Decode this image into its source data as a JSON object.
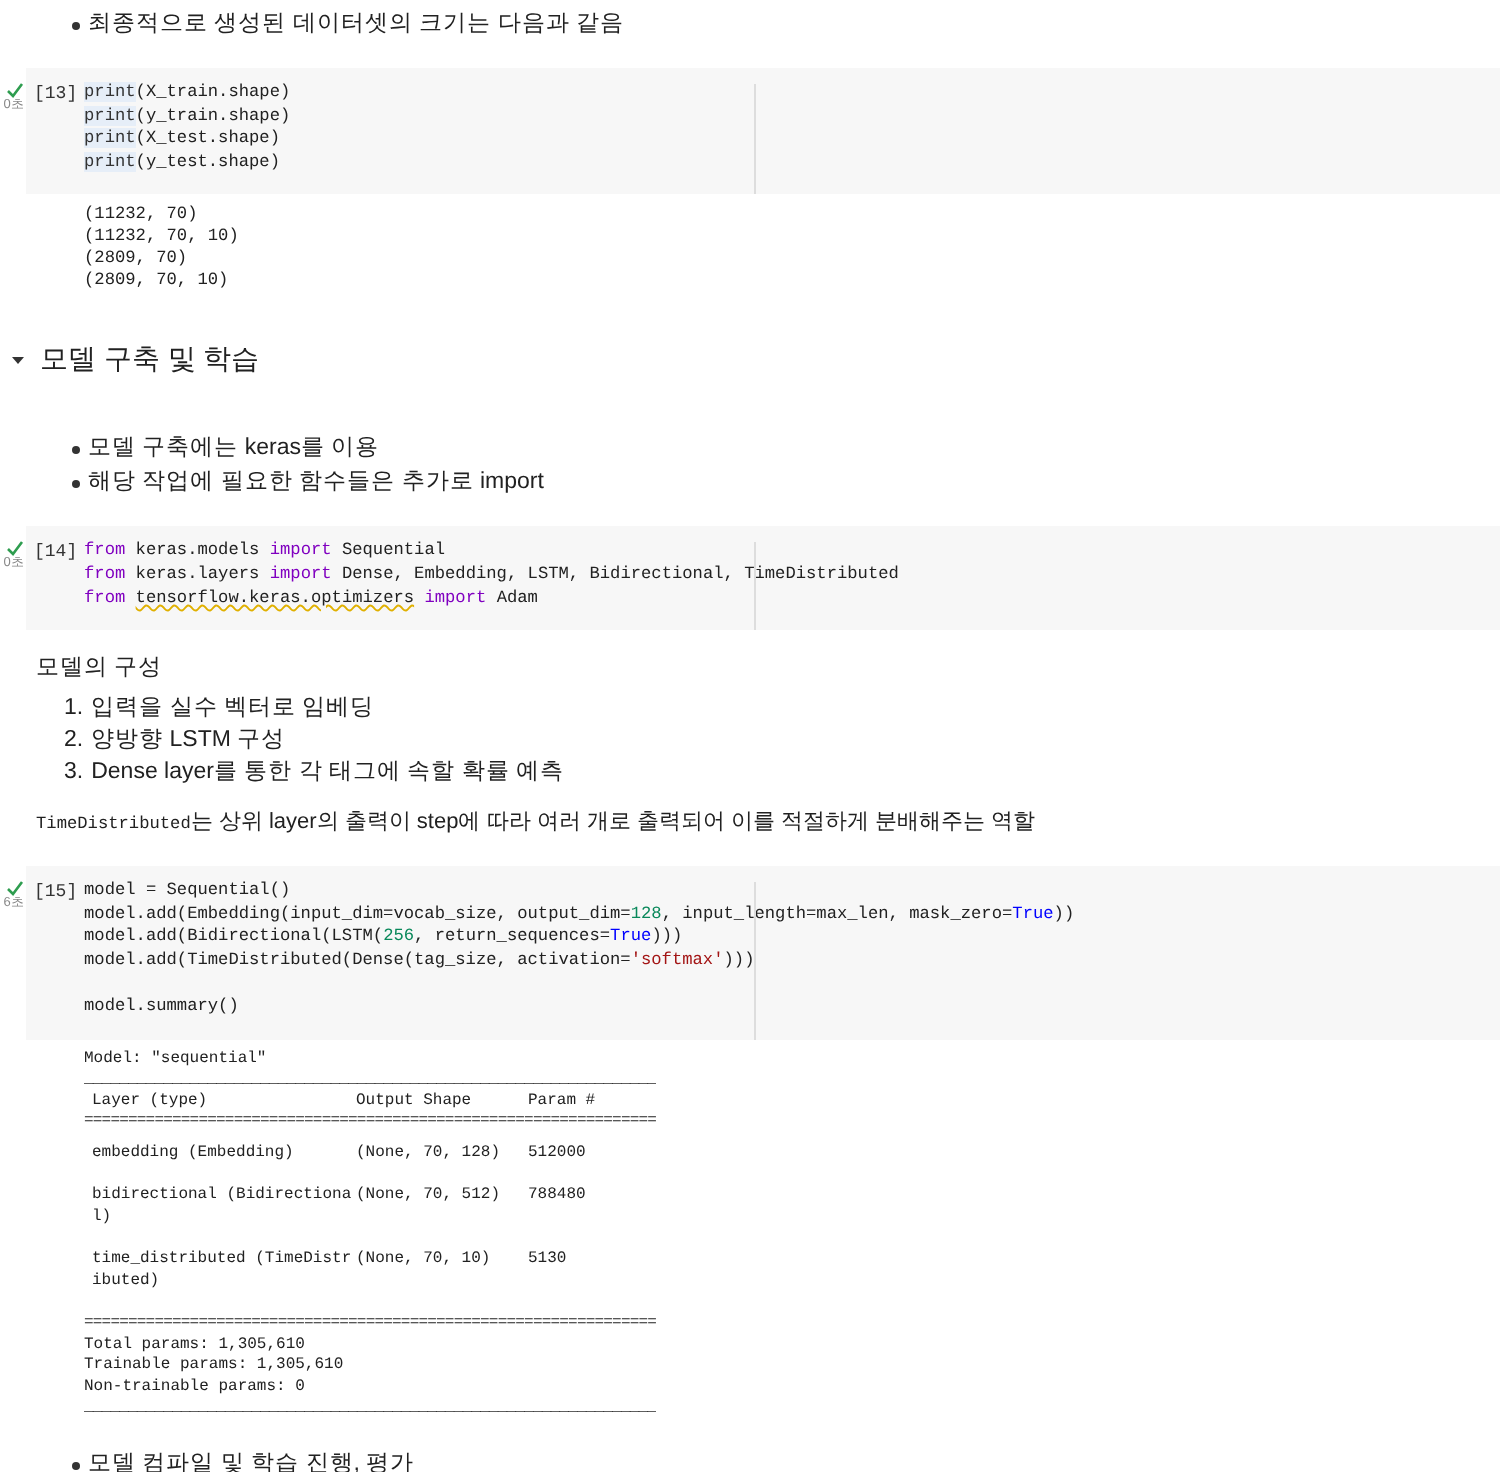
{
  "sections": [
    {
      "kind": "bullets",
      "items": [
        "최종적으로 생성된 데이터셋의 크기는 다음과 같음"
      ]
    },
    {
      "kind": "code",
      "count": "[13]",
      "succeeded": true,
      "time": "0초",
      "blocks": [
        [
          [
            {
              "text": "print",
              "kind": "builtin"
            },
            {
              "text": "(X_train.shape)",
              "kind": "plain"
            }
          ],
          [
            {
              "text": "print",
              "kind": "builtin"
            },
            {
              "text": "(y_train.shape)",
              "kind": "plain"
            }
          ],
          [
            {
              "text": "print",
              "kind": "builtin"
            },
            {
              "text": "(X_test.shape)",
              "kind": "plain"
            }
          ],
          [
            {
              "text": "print",
              "kind": "builtin"
            },
            {
              "text": "(y_test.shape)",
              "kind": "plain"
            }
          ]
        ]
      ]
    },
    {
      "kind": "output",
      "lines": [
        "(11232, 70)",
        "(11232, 70, 10)",
        "(2809, 70)",
        "(2809, 70, 10)"
      ]
    },
    {
      "kind": "heading",
      "text": "모델 구축 및 학습",
      "expanded": true
    },
    {
      "kind": "bullets",
      "items": [
        "모델 구축에는 keras를 이용",
        "해당 작업에 필요한 함수들은 추가로 import"
      ]
    },
    {
      "kind": "code",
      "count": "[14]",
      "succeeded": true,
      "time": "0초",
      "blocks": [
        [
          [
            {
              "text": "from",
              "kind": "keyword"
            },
            {
              "text": " keras.models ",
              "kind": "plain"
            },
            {
              "text": "import",
              "kind": "keyword"
            },
            {
              "text": " Sequential",
              "kind": "plain"
            }
          ],
          [
            {
              "text": "from",
              "kind": "keyword"
            },
            {
              "text": " keras.layers ",
              "kind": "plain"
            },
            {
              "text": "import",
              "kind": "keyword"
            },
            {
              "text": " Dense, Embedding, LSTM, Bidirectional, TimeDistributed",
              "kind": "plain"
            }
          ],
          [
            {
              "text": "from ",
              "kind": "keyword"
            },
            {
              "text": "tensorflow.keras.optimizers",
              "kind": "warning"
            },
            {
              "text": " import",
              "kind": "keyword"
            },
            {
              "text": " Adam",
              "kind": "plain"
            }
          ]
        ]
      ]
    },
    {
      "kind": "label",
      "text": "모델의 구성"
    },
    {
      "kind": "numbered",
      "items": [
        {
          "number": "1.",
          "text": "입력을 실수 벡터로 임베딩"
        },
        {
          "number": "2.",
          "text": "양방향 LSTM 구성"
        },
        {
          "number": "3.",
          "text": "Dense layer를 통한 각 태그에 속할 확률 예측"
        }
      ]
    },
    {
      "kind": "paragraph",
      "parts": [
        {
          "text": "TimeDistributed",
          "kind": "code"
        },
        {
          "text": "는 상위 layer의 출력이 step에 따라 여러 개로 출력되어 이를 적절하게 분배해주는 역할",
          "kind": "plain"
        }
      ]
    },
    {
      "kind": "code",
      "count": "[15]",
      "succeeded": true,
      "time": "6초",
      "blocks": [
        [
          [
            {
              "text": "model = Sequential()",
              "kind": "plain"
            }
          ],
          [
            {
              "text": "model.add(Embedding(input_dim=vocab_size, output_dim=",
              "kind": "plain"
            },
            {
              "text": "128",
              "kind": "number"
            },
            {
              "text": ", input_length=max_len, mask_zero=",
              "kind": "plain"
            },
            {
              "text": "True",
              "kind": "constant"
            },
            {
              "text": "))",
              "kind": "plain"
            }
          ],
          [
            {
              "text": "model.add(Bidirectional(LSTM(",
              "kind": "plain"
            },
            {
              "text": "256",
              "kind": "number"
            },
            {
              "text": ", return_sequences=",
              "kind": "plain"
            },
            {
              "text": "True",
              "kind": "constant"
            },
            {
              "text": ")))",
              "kind": "plain"
            }
          ],
          [
            {
              "text": "model.add(TimeDistributed(Dense(tag_size, activation=",
              "kind": "plain"
            },
            {
              "text": "'softmax'",
              "kind": "string"
            },
            {
              "text": ")))",
              "kind": "plain"
            }
          ]
        ],
        [
          [
            {
              "text": "model.summary()",
              "kind": "plain"
            }
          ]
        ]
      ]
    },
    {
      "kind": "summary",
      "title": "Model: \"sequential\"",
      "rule_top": "_________________________________________________________________",
      "header": [
        "Layer (type)",
        "Output Shape",
        "Param #"
      ],
      "rule_double": "=================================================================",
      "rows": [
        {
          "layer": [
            "embedding (Embedding)"
          ],
          "shape": "(None, 70, 128)",
          "params": "512000"
        },
        {
          "layer": [
            "bidirectional (Bidirectiona",
            "l)"
          ],
          "shape": "(None, 70, 512)",
          "params": "788480"
        },
        {
          "layer": [
            "time_distributed (TimeDistr",
            "ibuted)"
          ],
          "shape": "(None, 70, 10)",
          "params": "5130"
        }
      ],
      "rule_bottom": "=================================================================",
      "totals": [
        "Total params: 1,305,610",
        "Trainable params: 1,305,610",
        "Non-trainable params: 0"
      ],
      "rule_end": "_________________________________________________________________"
    },
    {
      "kind": "bullets",
      "items": [
        "모델 컴파일 및 학습 진행, 평가"
      ]
    }
  ]
}
